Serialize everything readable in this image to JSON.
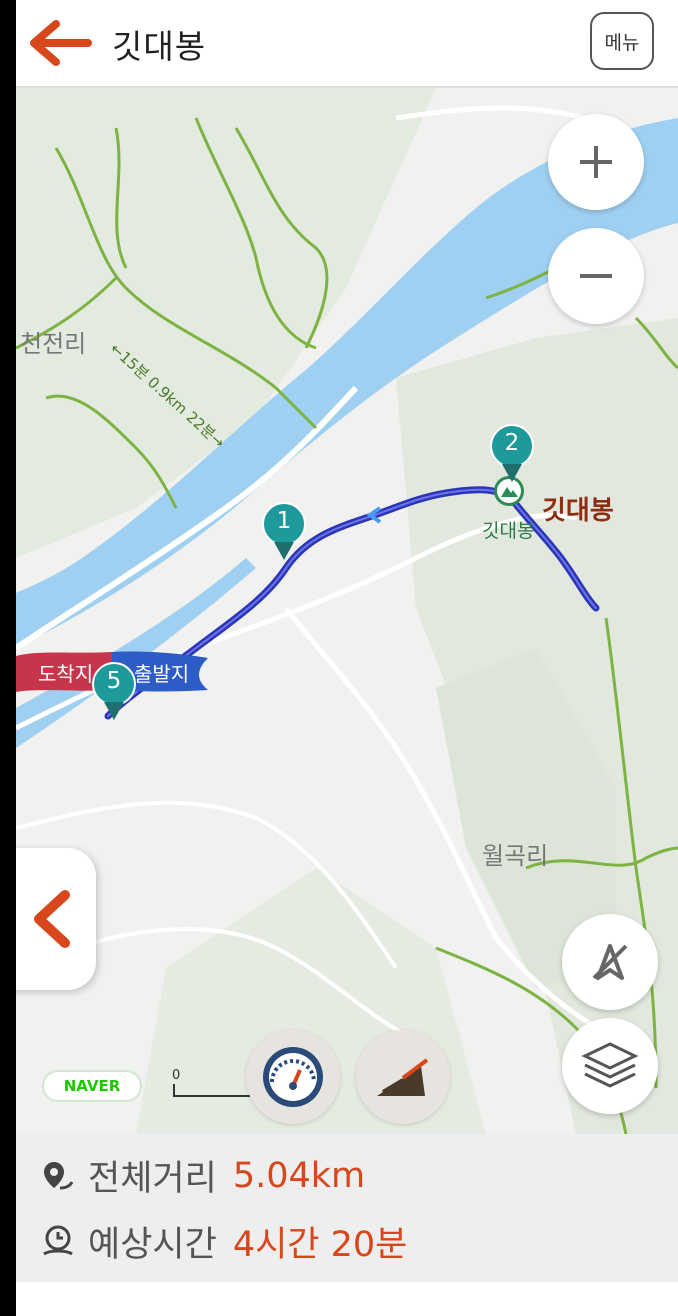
{
  "header": {
    "title": "깃대봉",
    "menu_label": "메뉴"
  },
  "map": {
    "place_labels": {
      "cheonjeon": "천전리",
      "wolgok": "월곡리",
      "peak_name": "깃대봉",
      "peak_small": "깃대봉"
    },
    "trail_annotation": "←15분 0.9km 22분→",
    "start_banner": {
      "left": "도착지",
      "right": "출발지"
    },
    "waypoints": [
      "1",
      "2",
      "5"
    ],
    "scale_label": "0",
    "brand": "NAVER"
  },
  "controls": {
    "zoom_in": "plus-icon",
    "zoom_out": "minus-icon",
    "compass": "compass-off-icon",
    "layers": "layers-icon",
    "gauge": "speedometer-icon",
    "elevation": "elevation-profile-icon"
  },
  "summary": {
    "distance_label": "전체거리",
    "distance_value": "5.04km",
    "time_label": "예상시간",
    "time_value": "4시간 20분"
  },
  "colors": {
    "accent": "#d8461b",
    "route": "#2a35b8",
    "water": "#9fd0f2",
    "trail": "#7cb342",
    "marker": "#1f9a9a"
  }
}
